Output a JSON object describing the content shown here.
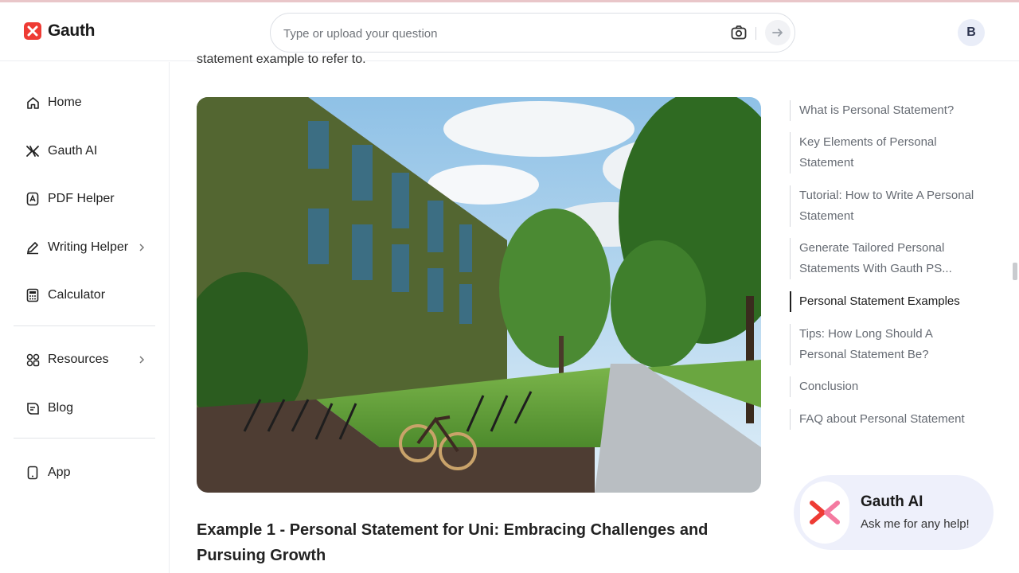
{
  "brand": {
    "name": "Gauth",
    "color": "#ee3b34"
  },
  "search": {
    "placeholder": "Type or upload your question"
  },
  "user": {
    "initial": "B"
  },
  "sidebar": {
    "items": [
      {
        "label": "Home",
        "icon": "home-icon"
      },
      {
        "label": "Gauth AI",
        "icon": "gauth-ai-icon"
      },
      {
        "label": "PDF Helper",
        "icon": "pdf-icon"
      },
      {
        "label": "Writing Helper",
        "icon": "pen-icon",
        "expandable": true
      },
      {
        "label": "Calculator",
        "icon": "calculator-icon"
      },
      {
        "label": "Resources",
        "icon": "grid-icon",
        "expandable": true
      },
      {
        "label": "Blog",
        "icon": "blog-icon"
      },
      {
        "label": "App",
        "icon": "phone-icon"
      }
    ]
  },
  "main": {
    "intro_text": "statement example to refer to.",
    "hero_image": "photo of ivy-covered university building with bike racks and tree-lined walkway",
    "example_title": "Example 1 - Personal Statement for Uni: Embracing Challenges and Pursuing Growth"
  },
  "toc": {
    "items": [
      {
        "label": "What is Personal Statement?",
        "active": false
      },
      {
        "label": "Key Elements of Personal Statement",
        "active": false
      },
      {
        "label": "Tutorial: How to Write A Personal Statement",
        "active": false
      },
      {
        "label": "Generate Tailored Personal Statements With Gauth PS...",
        "active": false
      },
      {
        "label": "Personal Statement Examples",
        "active": true
      },
      {
        "label": "Tips: How Long Should A Personal Statement Be?",
        "active": false
      },
      {
        "label": "Conclusion",
        "active": false
      },
      {
        "label": "FAQ about Personal Statement",
        "active": false
      }
    ]
  },
  "ai_card": {
    "title": "Gauth AI",
    "subtitle": "Ask me for any help!"
  }
}
